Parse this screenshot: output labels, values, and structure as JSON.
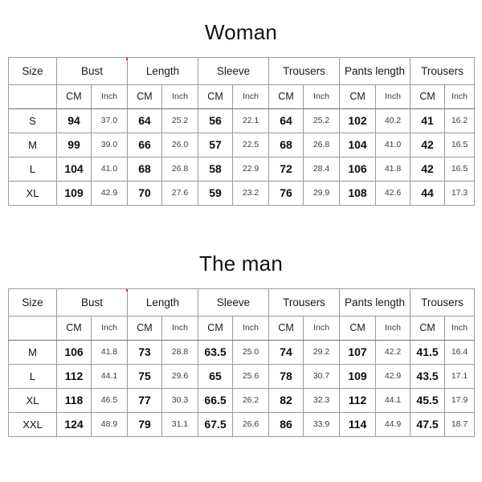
{
  "tables": [
    {
      "title": "Woman",
      "group_headers": [
        "Size",
        "Bust",
        "Length",
        "Sleeve",
        "Trousers",
        "Pants length",
        "Trousers"
      ],
      "unit_headers": [
        "CM",
        "Inch"
      ],
      "rows": [
        {
          "size": "S",
          "cells": [
            "94",
            "37.0",
            "64",
            "25.2",
            "56",
            "22.1",
            "64",
            "25.2",
            "102",
            "40.2",
            "41",
            "16.2"
          ]
        },
        {
          "size": "M",
          "cells": [
            "99",
            "39.0",
            "66",
            "26.0",
            "57",
            "22.5",
            "68",
            "26.8",
            "104",
            "41.0",
            "42",
            "16.5"
          ]
        },
        {
          "size": "L",
          "cells": [
            "104",
            "41.0",
            "68",
            "26.8",
            "58",
            "22.9",
            "72",
            "28.4",
            "106",
            "41.8",
            "42",
            "16.5"
          ]
        },
        {
          "size": "XL",
          "cells": [
            "109",
            "42.9",
            "70",
            "27.6",
            "59",
            "23.2",
            "76",
            "29.9",
            "108",
            "42.6",
            "44",
            "17.3"
          ]
        }
      ]
    },
    {
      "title": "The man",
      "group_headers": [
        "Size",
        "Bust",
        "Length",
        "Sleeve",
        "Trousers",
        "Pants length",
        "Trousers"
      ],
      "unit_headers": [
        "CM",
        "Inch"
      ],
      "rows": [
        {
          "size": "M",
          "cells": [
            "106",
            "41.8",
            "73",
            "28.8",
            "63.5",
            "25.0",
            "74",
            "29.2",
            "107",
            "42.2",
            "41.5",
            "16.4"
          ]
        },
        {
          "size": "L",
          "cells": [
            "112",
            "44.1",
            "75",
            "29.6",
            "65",
            "25.6",
            "78",
            "30.7",
            "109",
            "42.9",
            "43.5",
            "17.1"
          ]
        },
        {
          "size": "XL",
          "cells": [
            "118",
            "46.5",
            "77",
            "30.3",
            "66.5",
            "26.2",
            "82",
            "32.3",
            "112",
            "44.1",
            "45.5",
            "17.9"
          ]
        },
        {
          "size": "XXL",
          "cells": [
            "124",
            "48.9",
            "79",
            "31.1",
            "67.5",
            "26.6",
            "86",
            "33.9",
            "114",
            "44.9",
            "47.5",
            "18.7"
          ]
        }
      ]
    }
  ]
}
